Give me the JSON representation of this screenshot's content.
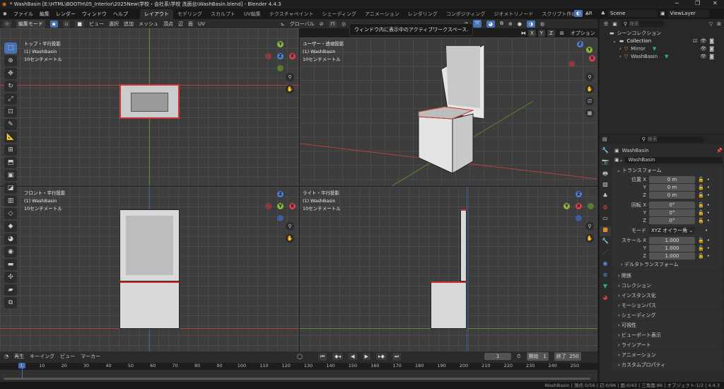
{
  "window": {
    "title": "* WashBasin [E:\\HTML\\BOOTH\\05_Interior\\2025New\\学校・会社系\\学校 洗面台\\WashBasin.blend] - Blender 4.4.3",
    "minimize": "─",
    "maximize": "❐",
    "close": "✕"
  },
  "menu": [
    "ファイル",
    "編集",
    "レンダー",
    "ウィンドウ",
    "ヘルプ"
  ],
  "workspaces": [
    "レイアウト",
    "モデリング",
    "スカルプト",
    "UV編集",
    "テクスチャペイント",
    "シェーディング",
    "アニメーション",
    "レンダリング",
    "コンポジティング",
    "ジオメトリノード",
    "スクリプト作成",
    "+"
  ],
  "active_workspace": 0,
  "scene": {
    "ar": "AR",
    "scene_name": "Scene",
    "view_layer": "ViewLayer"
  },
  "viewport_header": {
    "mode": "編集モード",
    "menus": [
      "ビュー",
      "選択",
      "追加",
      "メッシュ",
      "頂点",
      "辺",
      "面",
      "UV"
    ],
    "orientation": "グローバル",
    "axes": [
      "X",
      "Y",
      "Z"
    ],
    "options": "オプション"
  },
  "tooltip": "ウィンドウ内に表示中のアクティブワークスペース.",
  "viewports": [
    {
      "name": "トップ・平行投影",
      "object": "(1) WashBasin",
      "scale": "10センチメートル"
    },
    {
      "name": "ユーザー・透視投影",
      "object": "(1) WashBasin",
      "scale": "10センチメートル"
    },
    {
      "name": "フロント・平行投影",
      "object": "(1) WashBasin",
      "scale": "10センチメートル"
    },
    {
      "name": "ライト・平行投影",
      "object": "(1) WashBasin",
      "scale": "10センチメートル"
    }
  ],
  "outliner": {
    "search_placeholder": "検索",
    "root": "シーンコレクション",
    "collection": "Collection",
    "items": [
      "Mirror",
      "WashBasin"
    ]
  },
  "properties": {
    "search_placeholder": "検索",
    "object_name": "WashBasin",
    "datablock": "WashBasin",
    "transform_title": "トランスフォーム",
    "location": {
      "label": "位置",
      "x": "0 m",
      "y": "0 m",
      "z": "0 m"
    },
    "rotation": {
      "label": "回転",
      "x": "0°",
      "y": "0°",
      "z": "0°"
    },
    "mode": {
      "label": "モード",
      "value": "XYZ オイラー角"
    },
    "scale": {
      "label": "スケール",
      "x": "1.000",
      "y": "1.000",
      "z": "1.000"
    },
    "axis_labels": [
      "X",
      "Y",
      "Z"
    ],
    "delta": "デルタトランスフォーム",
    "panels": [
      "関係",
      "コレクション",
      "インスタンス化",
      "モーションパス",
      "シェーディング",
      "可視性",
      "ビューポート表示",
      "ラインアート",
      "アニメーション",
      "カスタムプロパティ"
    ]
  },
  "timeline": {
    "menus": [
      "再生",
      "キーイング",
      "ビュー",
      "マーカー"
    ],
    "current_frame": "1",
    "start_label": "開始",
    "start": "1",
    "end_label": "終了",
    "end": "250",
    "ticks": [
      "1",
      "10",
      "20",
      "30",
      "40",
      "50",
      "60",
      "70",
      "80",
      "90",
      "100",
      "110",
      "120",
      "130",
      "140",
      "150",
      "160",
      "170",
      "180",
      "190",
      "200",
      "210",
      "220",
      "230",
      "240",
      "250"
    ]
  },
  "status": "WashBasin | 頂点:0/56 | 辺:0/96 | 面:0/43 | 三角面:86 | オブジェクト:1/2 | 4.4.3",
  "colors": {
    "accent": "#4772b3",
    "x_axis": "#b04141",
    "y_axis": "#5a8a2c",
    "z_axis": "#3a5fa0"
  }
}
